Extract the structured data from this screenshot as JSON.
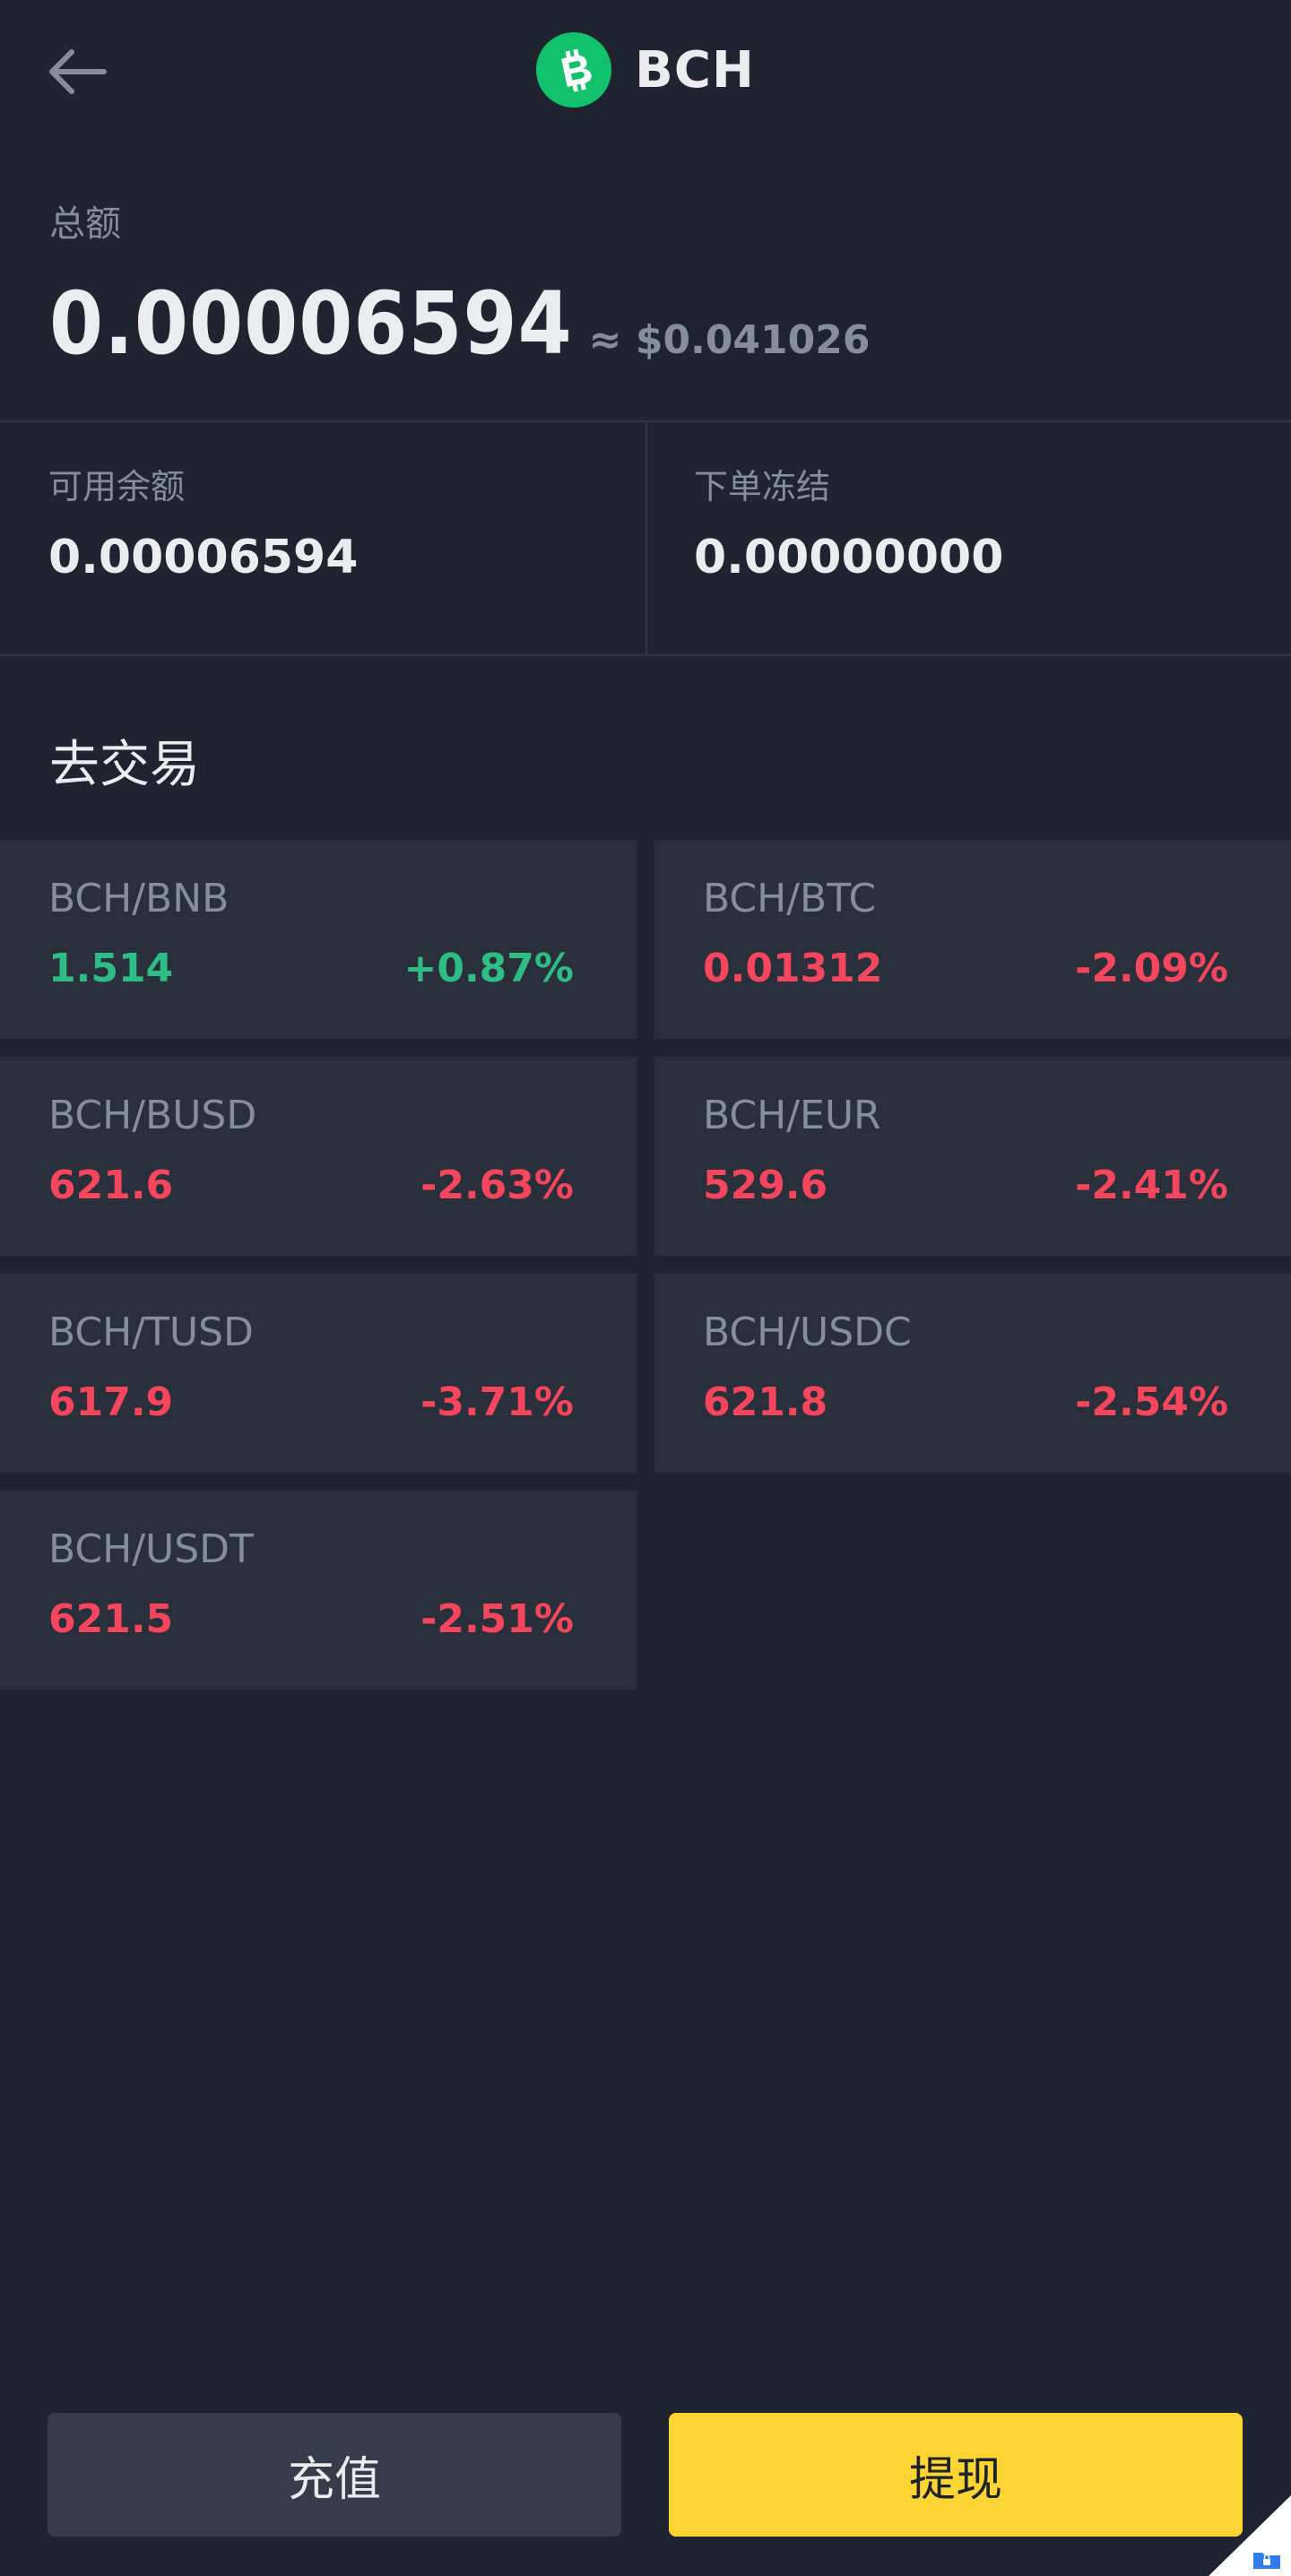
{
  "header": {
    "title": "BCH",
    "back_icon": "arrow-left-icon",
    "coin_icon": "bitcoin-cash-icon",
    "coin_color": "#11c16b"
  },
  "total": {
    "label": "总额",
    "value": "0.00006594",
    "approx": "≈ $0.041026"
  },
  "balances": {
    "available": {
      "label": "可用余额",
      "value": "0.00006594"
    },
    "frozen": {
      "label": "下单冻结",
      "value": "0.00000000"
    }
  },
  "trade": {
    "title": "去交易",
    "pairs": [
      {
        "name": "BCH/BNB",
        "price": "1.514",
        "change": "+0.87%",
        "direction": "up"
      },
      {
        "name": "BCH/BTC",
        "price": "0.01312",
        "change": "-2.09%",
        "direction": "down"
      },
      {
        "name": "BCH/BUSD",
        "price": "621.6",
        "change": "-2.63%",
        "direction": "down"
      },
      {
        "name": "BCH/EUR",
        "price": "529.6",
        "change": "-2.41%",
        "direction": "down"
      },
      {
        "name": "BCH/TUSD",
        "price": "617.9",
        "change": "-3.71%",
        "direction": "down"
      },
      {
        "name": "BCH/USDC",
        "price": "621.8",
        "change": "-2.54%",
        "direction": "down"
      },
      {
        "name": "BCH/USDT",
        "price": "621.5",
        "change": "-2.51%",
        "direction": "down"
      }
    ]
  },
  "actions": {
    "deposit_label": "充值",
    "withdraw_label": "提现"
  },
  "colors": {
    "background": "#1f2430",
    "card": "#29303c",
    "up": "#2ebd85",
    "down": "#f6465d",
    "accent": "#fcd535"
  }
}
